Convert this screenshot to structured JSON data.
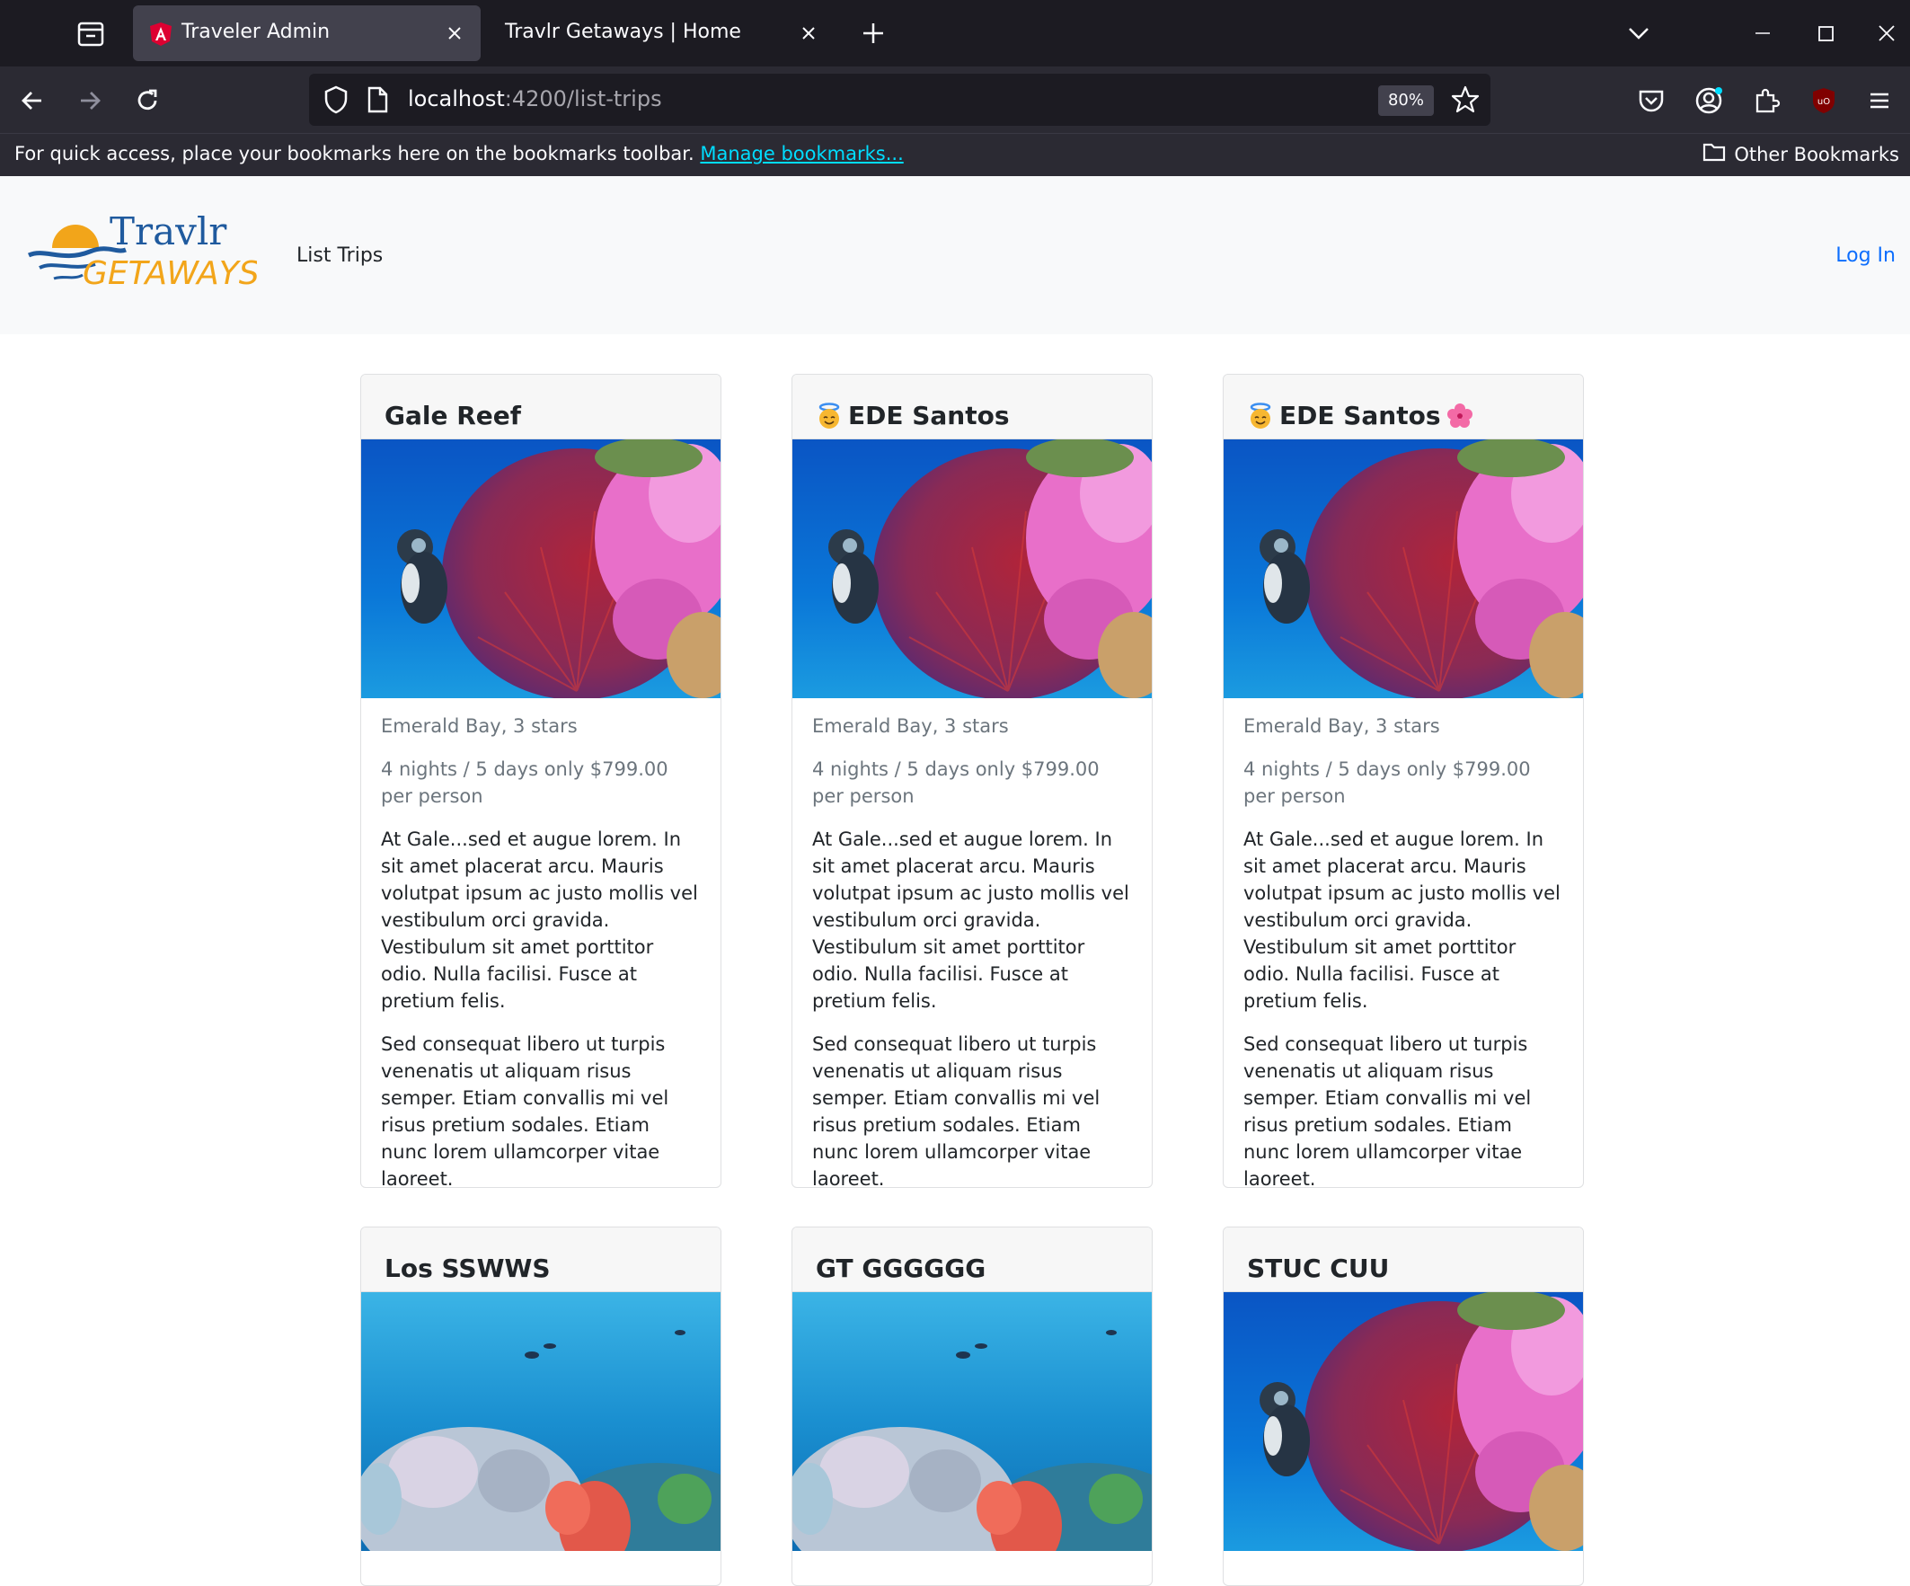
{
  "browser": {
    "tabs": [
      {
        "title": "Traveler Admin",
        "active": true,
        "favicon": "angular-icon"
      },
      {
        "title": "Travlr Getaways | Home",
        "active": false
      }
    ],
    "url_host": "localhost",
    "url_path": ":4200/list-trips",
    "zoom": "80%",
    "bookmarks_message": "For quick access, place your bookmarks here on the bookmarks toolbar.",
    "bookmarks_link": "Manage bookmarks...",
    "other_bookmarks": "Other Bookmarks"
  },
  "site": {
    "logo_top": "Travlr",
    "logo_bottom": "GETAWAYS",
    "nav_link": "List Trips",
    "login": "Log In"
  },
  "trips": [
    {
      "name": "Gale Reef",
      "image": "reef-gorgonian-diver",
      "resort": "Emerald Bay, 3 stars",
      "price": "4 nights / 5 days only $799.00 per person",
      "desc1": "At Gale...sed et augue lorem. In sit amet placerat arcu. Mauris volutpat ipsum ac justo mollis vel vestibulum orci gravida. Vestibulum sit amet porttitor odio. Nulla facilisi. Fusce at pretium felis.",
      "desc2": "Sed consequat libero ut turpis venenatis ut aliquam risus semper. Etiam convallis mi vel risus pretium sodales. Etiam nunc lorem ullamcorper vitae laoreet."
    },
    {
      "name": "EDE Santos",
      "prefix_emoji": "smiling-face-with-halo",
      "image": "reef-gorgonian-diver",
      "resort": "Emerald Bay, 3 stars",
      "price": "4 nights / 5 days only $799.00 per person",
      "desc1": "At Gale...sed et augue lorem. In sit amet placerat arcu. Mauris volutpat ipsum ac justo mollis vel vestibulum orci gravida. Vestibulum sit amet porttitor odio. Nulla facilisi. Fusce at pretium felis.",
      "desc2": "Sed consequat libero ut turpis venenatis ut aliquam risus semper. Etiam convallis mi vel risus pretium sodales. Etiam nunc lorem ullamcorper vitae laoreet."
    },
    {
      "name": "EDE Santos",
      "prefix_emoji": "smiling-face-with-halo",
      "suffix_emoji": "hibiscus",
      "image": "reef-gorgonian-diver",
      "resort": "Emerald Bay, 3 stars",
      "price": "4 nights / 5 days only $799.00 per person",
      "desc1": "At Gale...sed et augue lorem. In sit amet placerat arcu. Mauris volutpat ipsum ac justo mollis vel vestibulum orci gravida. Vestibulum sit amet porttitor odio. Nulla facilisi. Fusce at pretium felis.",
      "desc2": "Sed consequat libero ut turpis venenatis ut aliquam risus semper. Etiam convallis mi vel risus pretium sodales. Etiam nunc lorem ullamcorper vitae laoreet."
    },
    {
      "name": "Los SSWWS",
      "image": "reef-soft-coral"
    },
    {
      "name": "GT GGGGGG",
      "image": "reef-soft-coral"
    },
    {
      "name": "STUC CUU",
      "image": "reef-gorgonian-diver"
    }
  ],
  "colors": {
    "link": "#0d6efd",
    "chrome_dark": "#1c1b22",
    "chrome": "#2b2a33",
    "logo_blue": "#1f5a9e",
    "logo_orange": "#f2a51a"
  }
}
